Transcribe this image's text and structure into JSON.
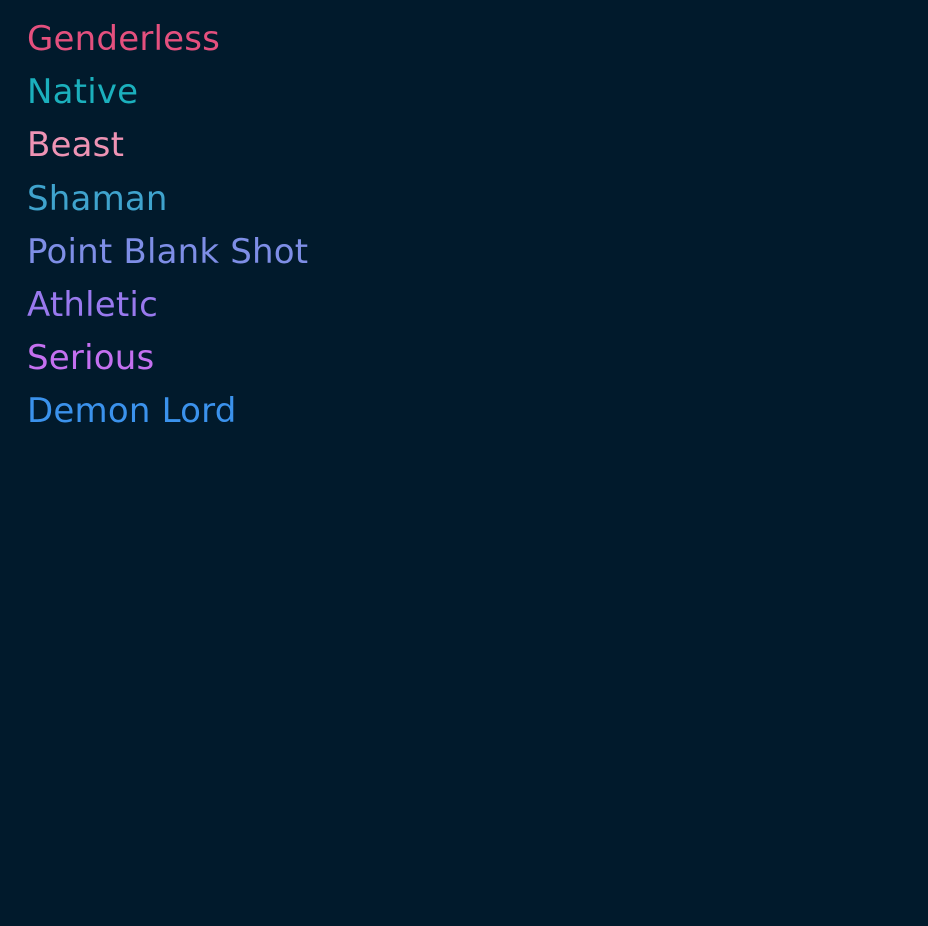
{
  "traits": [
    {
      "label": "Genderless",
      "color": "#e4507e"
    },
    {
      "label": "Native",
      "color": "#1bb0bd"
    },
    {
      "label": "Beast",
      "color": "#ee93b4"
    },
    {
      "label": "Shaman",
      "color": "#3fa3cd"
    },
    {
      "label": "Point Blank Shot",
      "color": "#7e8ee6"
    },
    {
      "label": "Athletic",
      "color": "#9979ee"
    },
    {
      "label": "Serious",
      "color": "#c470f0"
    },
    {
      "label": "Demon Lord",
      "color": "#3b92ec"
    }
  ]
}
